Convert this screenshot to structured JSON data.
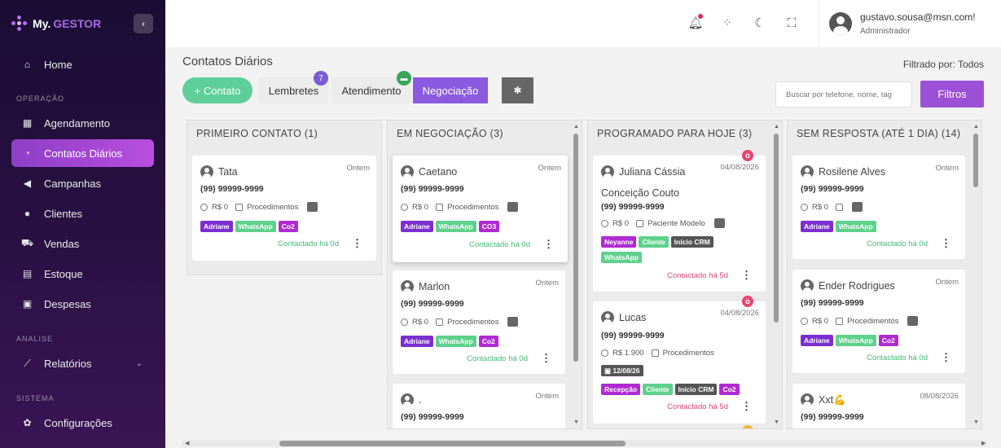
{
  "brand": {
    "part1": "My.",
    "part2": "GESTOR"
  },
  "sidebar": {
    "home": "Home",
    "section_operacao": "OPERAÇÃO",
    "agendamento": "Agendamento",
    "contatos": "Contatos Diários",
    "campanhas": "Campanhas",
    "clientes": "Clientes",
    "vendas": "Vendas",
    "estoque": "Estoque",
    "despesas": "Despesas",
    "section_analise": "ANALISE",
    "relatorios": "Relatórios",
    "section_sistema": "SISTEMA",
    "configuracoes": "Configurações"
  },
  "user": {
    "email": "gustavo.sousa@msn.com!",
    "role": "Administrador"
  },
  "page": {
    "title": "Contatos Diários",
    "filtered": "Filtrado por: Todos"
  },
  "toolbar": {
    "contato": "+ Contato",
    "lembretes": "Lembretes",
    "lembretes_count": "7",
    "atendimento": "Atendimento",
    "negociacao": "Negociação",
    "search_placeholder": "Buscar por telefone, nome, tag",
    "filtros": "Filtros"
  },
  "columns": [
    {
      "title": "PRIMEIRO CONTATO (1)"
    },
    {
      "title": "EM NEGOCIAÇÃO (3)"
    },
    {
      "title": "PROGRAMADO PARA HOJE (3)"
    },
    {
      "title": "SEM RESPOSTA (ATÉ 1 DIA) (14)"
    }
  ],
  "cards": {
    "tata": {
      "name": "Tata",
      "date": "Ontem",
      "phone": "(99) 99999-9999",
      "value": "R$ 0",
      "item": "Procedimentos",
      "tags": [
        "Adriane",
        "WhatsApp",
        "Co2"
      ],
      "contact": "Contactado há 0d"
    },
    "caetano": {
      "name": "Caetano",
      "date": "Ontem",
      "phone": "(99) 99999-9999",
      "value": "R$ 0",
      "item": "Procedimentos",
      "tags": [
        "Adriane",
        "WhatsApp",
        "CO3"
      ],
      "contact": "Contactado há 0d"
    },
    "marlon": {
      "name": "Marlon",
      "date": "Ontem",
      "phone": "(99) 99999-9999",
      "value": "R$ 0",
      "item": "Procedimentos",
      "tags": [
        "Adriane",
        "WhatsApp",
        "Co2"
      ],
      "contact": "Contactado há 0d"
    },
    "dot": {
      "name": ".",
      "date": "Ontem",
      "phone": "(99) 99999-9999"
    },
    "juliana": {
      "name": "Juliana Cássia",
      "name2": "Conceição Couto",
      "date": "04/08/2026",
      "phone": "(99) 99999-9999",
      "value": "R$ 0",
      "item": "Paciente Modelo",
      "tags": [
        "Neyanne",
        "Cliente",
        "Início CRM",
        "WhatsApp"
      ],
      "contact": "Contactado há 5d"
    },
    "lucas": {
      "name": "Lucas",
      "date": "04/08/2026",
      "phone": "(99) 99999-9999",
      "value": "R$ 1.900",
      "item": "Procedimentos",
      "sched": "12/08/26",
      "tags": [
        "Recepção",
        "Cliente",
        "Início CRM",
        "Co2"
      ],
      "contact": "Contactado há 5d"
    },
    "rosilene": {
      "name": "Rosilene Alves",
      "date": "Ontem",
      "phone": "(99) 99999-9999",
      "value": "R$ 0",
      "tags": [
        "Adriane",
        "WhatsApp"
      ],
      "contact": "Contactado há 0d"
    },
    "ender": {
      "name": "Ender Rodrigues",
      "date": "Ontem",
      "phone": "(99) 99999-9999",
      "value": "R$ 0",
      "item": "Procedimentos",
      "tags": [
        "Adriane",
        "WhatsApp",
        "Co2"
      ],
      "contact": "Contactado há 0d"
    },
    "xxt": {
      "name": "Xxt💪",
      "date": "08/08/2026",
      "phone": "(99) 99999-9999"
    }
  }
}
